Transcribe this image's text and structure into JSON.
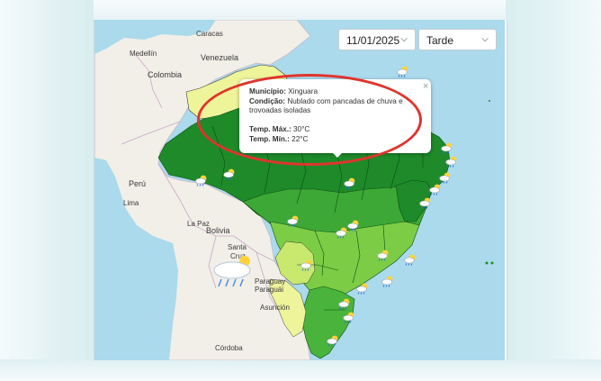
{
  "controls": {
    "date_value": "11/01/2025",
    "period_value": "Tarde"
  },
  "popup": {
    "municipio_label": "Município:",
    "municipio_value": "Xinguara",
    "condicao_label": "Condição:",
    "condicao_value": "Nublado com pancadas de chuva e",
    "condicao_value_2": "trovoadas isoladas",
    "temp_max_label": "Temp. Máx.:",
    "temp_max_value": "30°C",
    "temp_min_label": "Temp. Mín.:",
    "temp_min_value": "22°C",
    "close_symbol": "×"
  },
  "map_labels": {
    "caracas": "Caracas",
    "medellin": "Medellín",
    "colombia": "Colombia",
    "venezuela": "Venezuela",
    "peru": "Perú",
    "lima": "Lima",
    "la_paz": "La Paz",
    "bolivia": "Bolivia",
    "santa_cruz_1": "Santa",
    "santa_cruz_2": "Cruz",
    "paraguay_1": "Paraguay",
    "paraguay_2": "Paraguái",
    "asuncion": "Asunción",
    "cordoba": "Córdoba"
  },
  "colors": {
    "ocean": "#aadaec",
    "land": "#f1efe8",
    "brazil_dark": "#1f8c2a",
    "brazil_mid": "#3eaa36",
    "brazil_light": "#7fce46",
    "brazil_yellowgreen": "#d6ec7a",
    "brazil_pale": "#f0f59a",
    "highlight": "#e0342c"
  },
  "weather_icons": [
    "sun-cloud-rain-icon",
    "cloud-rain-icon"
  ]
}
